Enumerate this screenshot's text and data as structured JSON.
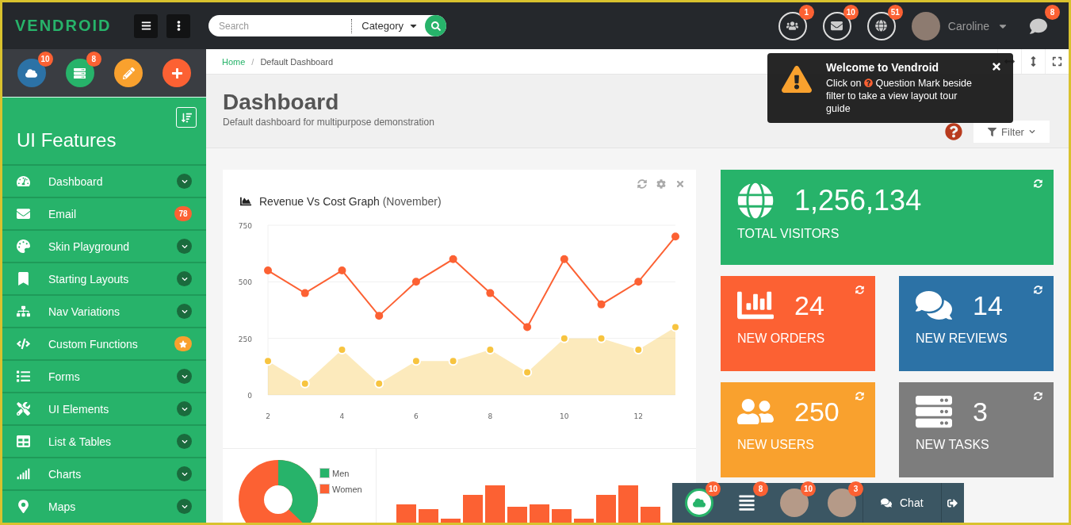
{
  "header": {
    "logo": "VENDROID",
    "search": {
      "placeholder": "Search"
    },
    "category": "Category",
    "notifications": [
      {
        "kind": "users",
        "count": "1"
      },
      {
        "kind": "mail",
        "count": "10"
      },
      {
        "kind": "globe",
        "count": "51"
      }
    ],
    "user": {
      "name": "Caroline"
    },
    "chat_count": "8"
  },
  "tour": {
    "title": "Welcome to Vendroid",
    "text_before": "Click on",
    "text_after": "Question Mark beside filter to take a view layout tour guide"
  },
  "sidebar": {
    "quick": [
      {
        "kind": "cloud",
        "badge": "10",
        "color": "#2c72a6"
      },
      {
        "kind": "server",
        "badge": "8",
        "color": "#27b36a"
      },
      {
        "kind": "pencil",
        "color": "#f9a12e"
      },
      {
        "kind": "plus",
        "color": "#fc6133"
      }
    ],
    "title": "UI Features",
    "items": [
      {
        "label": "Dashboard",
        "kind": "chevron"
      },
      {
        "label": "Email",
        "kind": "count",
        "badge": "78"
      },
      {
        "label": "Skin Playground",
        "kind": "chevron"
      },
      {
        "label": "Starting Layouts",
        "kind": "chevron"
      },
      {
        "label": "Nav Variations",
        "kind": "chevron"
      },
      {
        "label": "Custom Functions",
        "kind": "star"
      },
      {
        "label": "Forms",
        "kind": "chevron"
      },
      {
        "label": "UI Elements",
        "kind": "chevron"
      },
      {
        "label": "List & Tables",
        "kind": "chevron"
      },
      {
        "label": "Charts",
        "kind": "chevron"
      },
      {
        "label": "Maps",
        "kind": "chevron"
      }
    ]
  },
  "breadcrumb_separator": "/",
  "breadcrumb": [
    {
      "label": "Home",
      "selected": false
    },
    {
      "label": "Default Dashboard",
      "selected": true
    }
  ],
  "page": {
    "title": "Dashboard",
    "subtitle": "Default dashboard for multipurpose demonstration",
    "filter": "Filter"
  },
  "graph_card": {
    "title": "Revenue Vs Cost Graph",
    "period": "(November)",
    "chart_data": {
      "type": "line",
      "x": [
        2,
        3,
        4,
        5,
        6,
        7,
        8,
        9,
        10,
        11,
        12,
        13
      ],
      "xlim": [
        2,
        13
      ],
      "ylim": [
        0,
        750
      ],
      "xticks": [
        2,
        4,
        6,
        8,
        10,
        12
      ],
      "yticks": [
        0,
        250,
        500,
        750
      ],
      "series": [
        {
          "type": "line",
          "marker": "circle",
          "color": "#fc6133",
          "values": [
            550,
            450,
            550,
            350,
            500,
            600,
            450,
            300,
            600,
            400,
            500,
            700
          ]
        },
        {
          "type": "area",
          "marker": "circle",
          "color": "#f7c440",
          "values": [
            150,
            50,
            200,
            50,
            150,
            150,
            200,
            100,
            250,
            250,
            200,
            300
          ]
        }
      ]
    }
  },
  "gender_legend": [
    {
      "label": "Men",
      "color": "#27b36a"
    },
    {
      "label": "Women",
      "color": "#fc6133"
    }
  ],
  "stats": [
    {
      "value": "1,256,134",
      "label": "TOTAL VISITORS",
      "color": "#27b36a"
    },
    {
      "value": "24",
      "label": "NEW ORDERS",
      "color": "#fc6133"
    },
    {
      "value": "14",
      "label": "NEW REVIEWS",
      "color": "#2c72a6"
    },
    {
      "value": "250",
      "label": "NEW USERS",
      "color": "#f9a12e"
    },
    {
      "value": "3",
      "label": "NEW TASKS",
      "color": "#7d7d7d"
    }
  ],
  "chat_bar": {
    "items": [
      {
        "kind": "cloud",
        "badge": "10"
      },
      {
        "kind": "list",
        "badge": "8"
      },
      {
        "kind": "avatar",
        "badge": "10"
      },
      {
        "kind": "avatar",
        "badge": "3"
      }
    ],
    "chat": "Chat"
  }
}
